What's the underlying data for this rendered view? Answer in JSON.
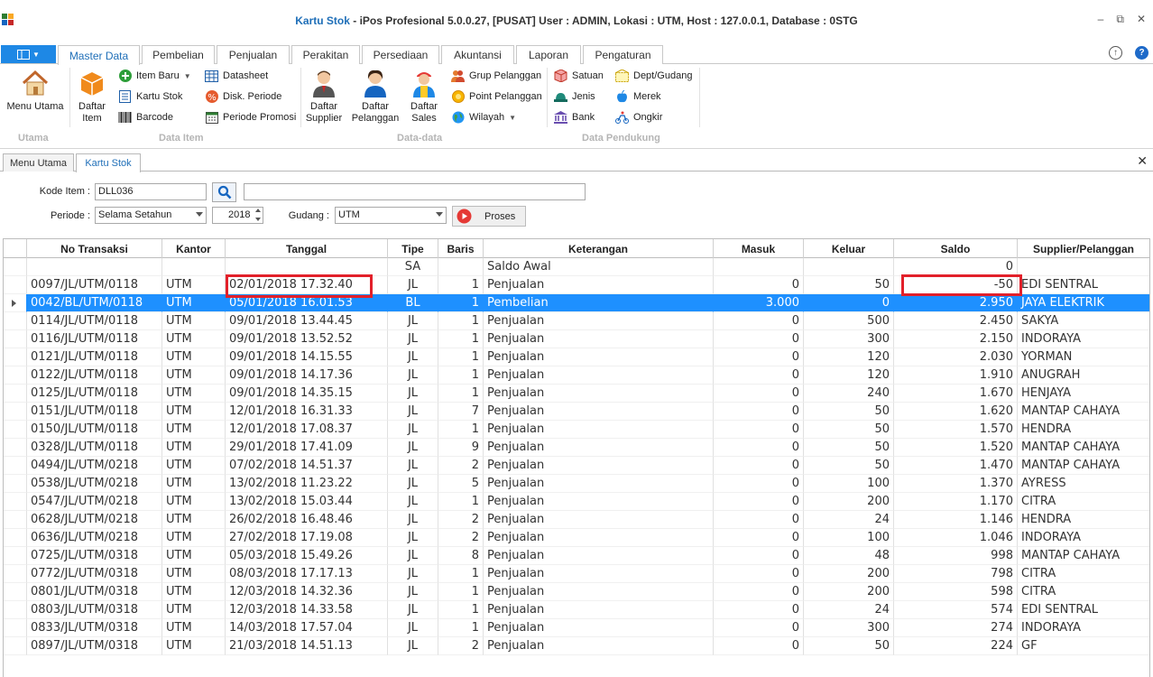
{
  "window": {
    "title_app": "Kartu Stok",
    "title_rest": " - iPos Profesional 5.0.0.27, [PUSAT] User : ADMIN, Lokasi : UTM, Host : 127.0.0.1, Database : 0STG"
  },
  "ribbon_tabs": [
    "Master Data",
    "Pembelian",
    "Penjualan",
    "Perakitan",
    "Persediaan",
    "Akuntansi",
    "Laporan",
    "Pengaturan"
  ],
  "ribbon": {
    "menu_utama": "Menu Utama",
    "daftar_item_1": "Daftar",
    "daftar_item_2": "Item",
    "item_baru": "Item Baru",
    "kartu_stok": "Kartu Stok",
    "barcode": "Barcode",
    "datasheet": "Datasheet",
    "disk_periode": "Disk. Periode",
    "periode_promosi": "Periode Promosi",
    "daftar_supplier_1": "Daftar",
    "daftar_supplier_2": "Supplier",
    "daftar_pelanggan_1": "Daftar",
    "daftar_pelanggan_2": "Pelanggan",
    "daftar_sales_1": "Daftar",
    "daftar_sales_2": "Sales",
    "grup_pelanggan": "Grup Pelanggan",
    "point_pelanggan": "Point Pelanggan",
    "wilayah": "Wilayah",
    "satuan": "Satuan",
    "jenis": "Jenis",
    "bank": "Bank",
    "dept_gudang": "Dept/Gudang",
    "merek": "Merek",
    "ongkir": "Ongkir",
    "group_utama": "Utama",
    "group_data_item": "Data Item",
    "group_data_data": "Data-data",
    "group_data_pendukung": "Data Pendukung"
  },
  "doc_tabs": [
    "Menu Utama",
    "Kartu Stok"
  ],
  "form": {
    "kode_item_label": "Kode Item :",
    "kode_item_value": "DLL036",
    "item_name_value": "",
    "periode_label": "Periode :",
    "periode_value": "Selama Setahun",
    "year_value": "2018",
    "gudang_label": "Gudang :",
    "gudang_value": "UTM",
    "proses_label": "Proses"
  },
  "table": {
    "columns": [
      "No Transaksi",
      "Kantor",
      "Tanggal",
      "Tipe",
      "Baris",
      "Keterangan",
      "Masuk",
      "Keluar",
      "Saldo",
      "Supplier/Pelanggan"
    ],
    "rows": [
      [
        "",
        "",
        "",
        "SA",
        "",
        "Saldo Awal",
        "",
        "",
        "0",
        ""
      ],
      [
        "0097/JL/UTM/0118",
        "UTM",
        "02/01/2018 17.32.40",
        "JL",
        "1",
        "Penjualan",
        "0",
        "50",
        "-50",
        "EDI SENTRAL"
      ],
      [
        "0042/BL/UTM/0118",
        "UTM",
        "05/01/2018 16.01.53",
        "BL",
        "1",
        "Pembelian",
        "3.000",
        "0",
        "2.950",
        "JAYA ELEKTRIK"
      ],
      [
        "0114/JL/UTM/0118",
        "UTM",
        "09/01/2018 13.44.45",
        "JL",
        "1",
        "Penjualan",
        "0",
        "500",
        "2.450",
        "SAKYA"
      ],
      [
        "0116/JL/UTM/0118",
        "UTM",
        "09/01/2018 13.52.52",
        "JL",
        "1",
        "Penjualan",
        "0",
        "300",
        "2.150",
        "INDORAYA"
      ],
      [
        "0121/JL/UTM/0118",
        "UTM",
        "09/01/2018 14.15.55",
        "JL",
        "1",
        "Penjualan",
        "0",
        "120",
        "2.030",
        "YORMAN"
      ],
      [
        "0122/JL/UTM/0118",
        "UTM",
        "09/01/2018 14.17.36",
        "JL",
        "1",
        "Penjualan",
        "0",
        "120",
        "1.910",
        "ANUGRAH"
      ],
      [
        "0125/JL/UTM/0118",
        "UTM",
        "09/01/2018 14.35.15",
        "JL",
        "1",
        "Penjualan",
        "0",
        "240",
        "1.670",
        "HENJAYA"
      ],
      [
        "0151/JL/UTM/0118",
        "UTM",
        "12/01/2018 16.31.33",
        "JL",
        "7",
        "Penjualan",
        "0",
        "50",
        "1.620",
        "MANTAP CAHAYA"
      ],
      [
        "0150/JL/UTM/0118",
        "UTM",
        "12/01/2018 17.08.37",
        "JL",
        "1",
        "Penjualan",
        "0",
        "50",
        "1.570",
        "HENDRA"
      ],
      [
        "0328/JL/UTM/0118",
        "UTM",
        "29/01/2018 17.41.09",
        "JL",
        "9",
        "Penjualan",
        "0",
        "50",
        "1.520",
        "MANTAP CAHAYA"
      ],
      [
        "0494/JL/UTM/0218",
        "UTM",
        "07/02/2018 14.51.37",
        "JL",
        "2",
        "Penjualan",
        "0",
        "50",
        "1.470",
        "MANTAP CAHAYA"
      ],
      [
        "0538/JL/UTM/0218",
        "UTM",
        "13/02/2018 11.23.22",
        "JL",
        "5",
        "Penjualan",
        "0",
        "100",
        "1.370",
        "AYRESS"
      ],
      [
        "0547/JL/UTM/0218",
        "UTM",
        "13/02/2018 15.03.44",
        "JL",
        "1",
        "Penjualan",
        "0",
        "200",
        "1.170",
        "CITRA"
      ],
      [
        "0628/JL/UTM/0218",
        "UTM",
        "26/02/2018 16.48.46",
        "JL",
        "2",
        "Penjualan",
        "0",
        "24",
        "1.146",
        "HENDRA"
      ],
      [
        "0636/JL/UTM/0218",
        "UTM",
        "27/02/2018 17.19.08",
        "JL",
        "2",
        "Penjualan",
        "0",
        "100",
        "1.046",
        "INDORAYA"
      ],
      [
        "0725/JL/UTM/0318",
        "UTM",
        "05/03/2018 15.49.26",
        "JL",
        "8",
        "Penjualan",
        "0",
        "48",
        "998",
        "MANTAP CAHAYA"
      ],
      [
        "0772/JL/UTM/0318",
        "UTM",
        "08/03/2018 17.17.13",
        "JL",
        "1",
        "Penjualan",
        "0",
        "200",
        "798",
        "CITRA"
      ],
      [
        "0801/JL/UTM/0318",
        "UTM",
        "12/03/2018 14.32.36",
        "JL",
        "1",
        "Penjualan",
        "0",
        "200",
        "598",
        "CITRA"
      ],
      [
        "0803/JL/UTM/0318",
        "UTM",
        "12/03/2018 14.33.58",
        "JL",
        "1",
        "Penjualan",
        "0",
        "24",
        "574",
        "EDI SENTRAL"
      ],
      [
        "0833/JL/UTM/0318",
        "UTM",
        "14/03/2018 17.57.04",
        "JL",
        "1",
        "Penjualan",
        "0",
        "300",
        "274",
        "INDORAYA"
      ],
      [
        "0897/JL/UTM/0318",
        "UTM",
        "21/03/2018 14.51.13",
        "JL",
        "2",
        "Penjualan",
        "0",
        "50",
        "224",
        "GF"
      ]
    ],
    "selected_row": 2
  },
  "colors": {
    "accent": "#1e88e5",
    "selection": "#1e90ff",
    "highlight_box": "#e2202a"
  }
}
